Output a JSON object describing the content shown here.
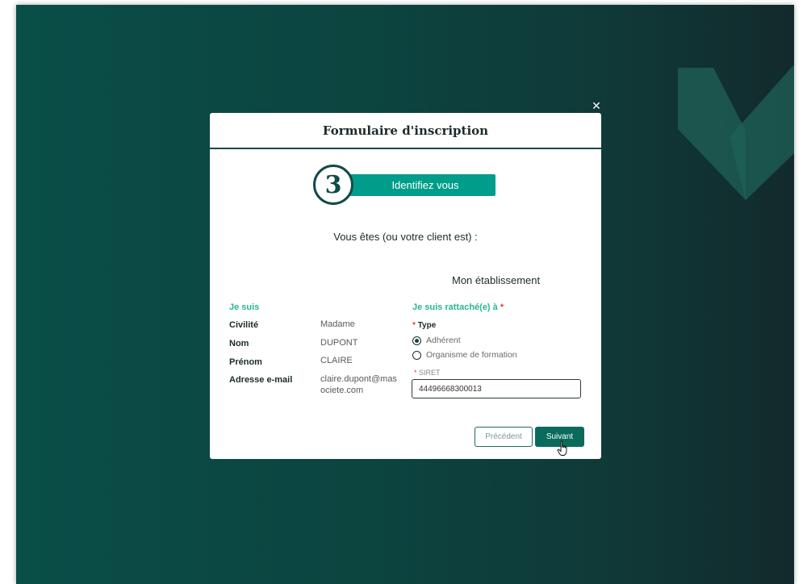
{
  "modal": {
    "title": "Formulaire d'inscription",
    "close_icon": "close-icon"
  },
  "step": {
    "number": "3",
    "label": "Identifiez vous"
  },
  "question": "Vous êtes (ou votre client est) :",
  "establishment": {
    "title": "Mon établissement",
    "section_label": "Je suis rattaché(e) à",
    "required_mark": "*",
    "type_label": "Type",
    "type_options": [
      "Adhérent",
      "Organisme de formation"
    ],
    "type_selected": "Adhérent",
    "siret_label": "SIRET",
    "siret_value": "44496668300013"
  },
  "identity": {
    "section_label": "Je suis",
    "rows": [
      {
        "label": "Civilité",
        "value": "Madame"
      },
      {
        "label": "Nom",
        "value": "DUPONT"
      },
      {
        "label": "Prénom",
        "value": "CLAIRE"
      },
      {
        "label": "Adresse e-mail",
        "value": "claire.dupont@masociete.com"
      }
    ]
  },
  "actions": {
    "previous_label": "Précédent",
    "next_label": "Suivant"
  },
  "colors": {
    "background_dark": "#0c4440",
    "accent_teal": "#009e8a",
    "label_green": "#2ab596",
    "next_button": "#0a6b5c"
  }
}
